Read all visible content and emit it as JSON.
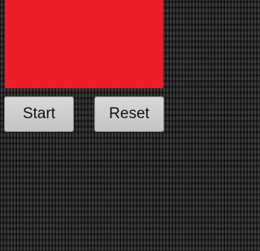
{
  "display": {
    "color": "#ee1e28"
  },
  "buttons": {
    "start_label": "Start",
    "reset_label": "Reset"
  }
}
